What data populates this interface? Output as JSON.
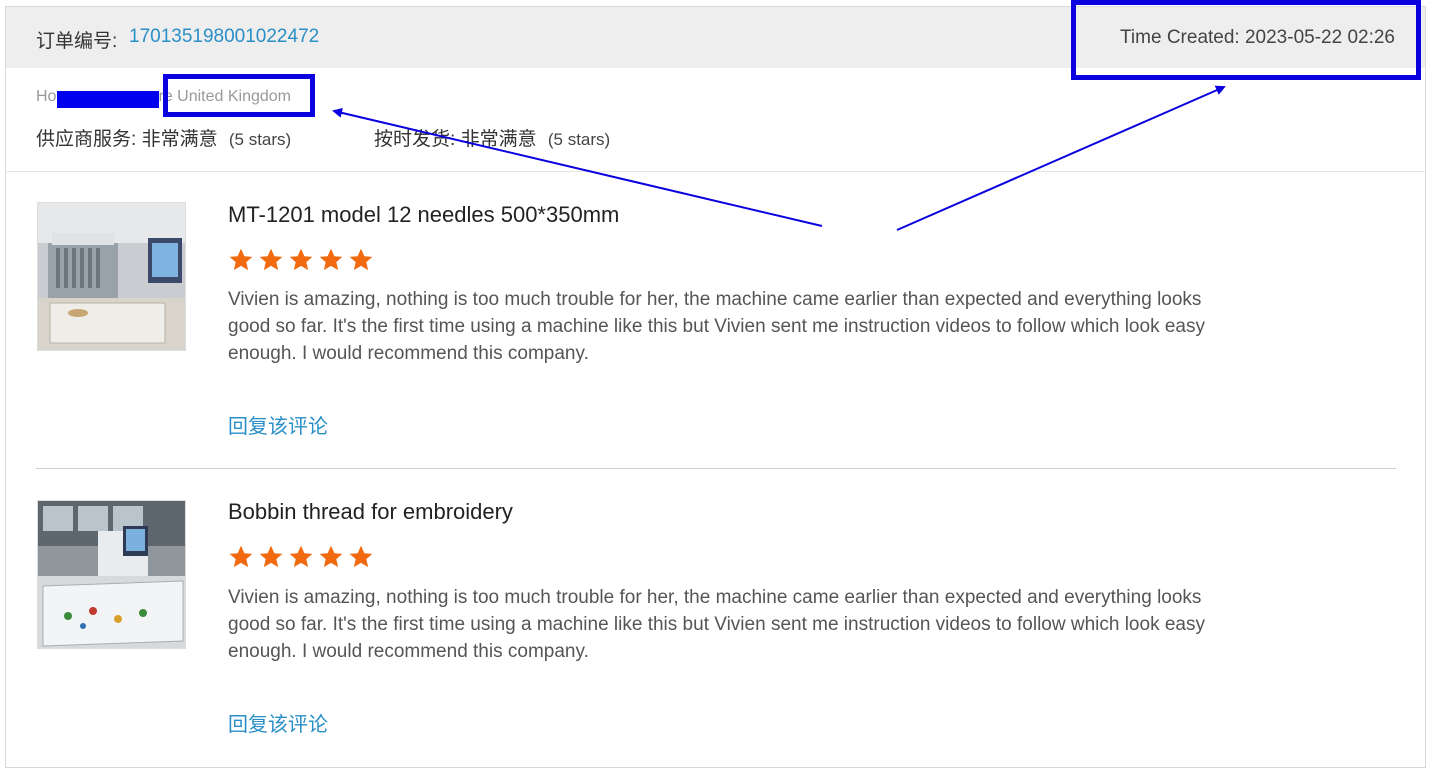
{
  "order": {
    "label": "订单编号:",
    "id": "170135198001022472",
    "time_created": "Time Created: 2023-05-22 02:26"
  },
  "buyer": {
    "name_start": "Ho",
    "name_mid": "re",
    "country": "United Kingdom"
  },
  "ratings": [
    {
      "label": "供应商服务:",
      "value": "非常满意",
      "stars_text": "(5 stars)"
    },
    {
      "label": "按时发货:",
      "value": "非常满意",
      "stars_text": "(5 stars)"
    }
  ],
  "reviews": [
    {
      "product": "MT-1201 model 12 needles 500*350mm",
      "stars": 5,
      "text": "Vivien is amazing, nothing is too much trouble for her, the machine came earlier than expected and everything looks good so far.  It's the first time using a machine like this but Vivien sent me instruction videos to follow which look easy enough.  I would recommend this company.",
      "reply": "回复该评论",
      "thumb_icon": "embroidery-machine-photo"
    },
    {
      "product": "Bobbin thread for embroidery",
      "stars": 5,
      "text": "Vivien is amazing, nothing is too much trouble for her, the machine came earlier than expected and everything looks good so far.  It's the first time using a machine like this but Vivien sent me instruction videos to follow which look easy enough.  I would recommend this company.",
      "reply": "回复该评论",
      "thumb_icon": "embroidery-workshop-photo"
    }
  ],
  "colors": {
    "link": "#2a8fc7",
    "star": "#f26a10",
    "annotation": "#0a00e0",
    "header_bg": "#eeeeee"
  }
}
